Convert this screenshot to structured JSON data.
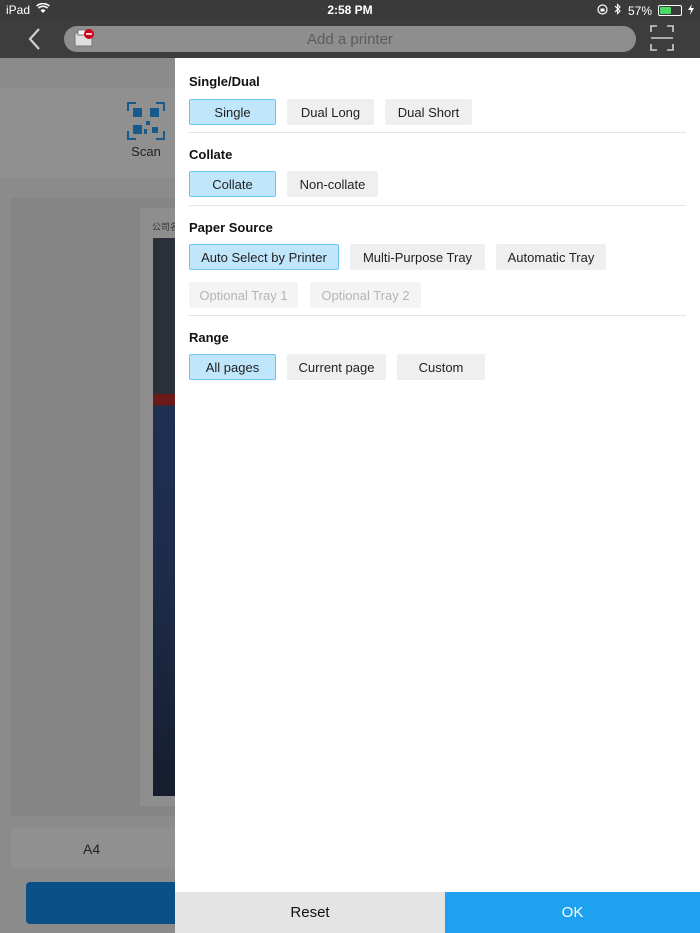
{
  "status_bar": {
    "device": "iPad",
    "time": "2:58 PM",
    "battery_percent": "57%",
    "battery_level": 0.57,
    "icons": [
      "wifi-icon",
      "orientation-lock-icon",
      "bluetooth-icon",
      "battery-icon",
      "charging-icon"
    ]
  },
  "nav": {
    "printer_placeholder": "Add a printer",
    "icons": [
      "back-chevron-icon",
      "printer-error-icon",
      "scan-frame-icon"
    ]
  },
  "background": {
    "scan_label": "Scan",
    "paper_tag": "公司名",
    "paper_size": "A4"
  },
  "panel": {
    "sections": [
      {
        "title": "Single/Dual",
        "options": [
          {
            "label": "Single",
            "state": "active"
          },
          {
            "label": "Dual Long",
            "state": "normal"
          },
          {
            "label": "Dual Short",
            "state": "normal"
          }
        ]
      },
      {
        "title": "Collate",
        "options": [
          {
            "label": "Collate",
            "state": "active"
          },
          {
            "label": "Non-collate",
            "state": "normal"
          }
        ]
      },
      {
        "title": "Paper Source",
        "options": [
          {
            "label": "Auto Select by Printer",
            "state": "active"
          },
          {
            "label": "Multi-Purpose Tray",
            "state": "normal"
          },
          {
            "label": "Automatic Tray",
            "state": "normal"
          },
          {
            "label": "Optional Tray 1",
            "state": "disabled"
          },
          {
            "label": "Optional Tray 2",
            "state": "disabled"
          }
        ]
      },
      {
        "title": "Range",
        "options": [
          {
            "label": "All pages",
            "state": "active"
          },
          {
            "label": "Current page",
            "state": "normal"
          },
          {
            "label": "Custom",
            "state": "normal"
          }
        ]
      }
    ]
  },
  "footer": {
    "reset_label": "Reset",
    "ok_label": "OK"
  },
  "colors": {
    "accent": "#1ea2f0",
    "active_fill": "#bfe6fb",
    "active_border": "#6cc5f2",
    "battery_green": "#4cd964"
  }
}
